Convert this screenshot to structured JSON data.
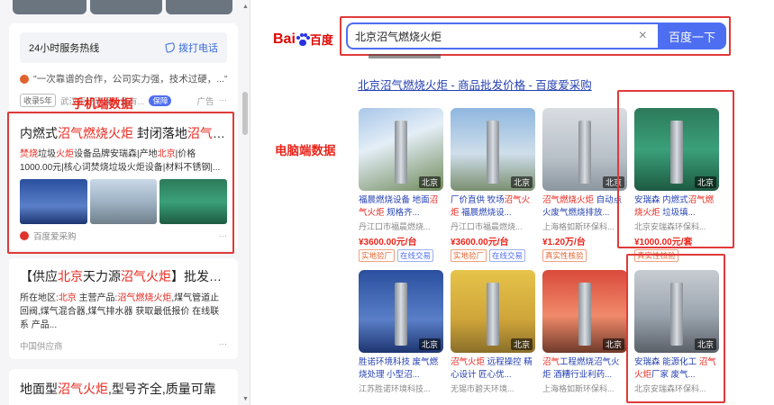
{
  "mobile": {
    "hotline": {
      "label": "24小时服务热线",
      "call": "拨打电话"
    },
    "quote": "\"一次靠谱的合作，公司实力强，技术过硬，...\"",
    "meta": {
      "badge_years": "收录5年",
      "company": "武汉炬炀环保设备有...",
      "badge_bao": "保障",
      "ad": "广告",
      "more": "···"
    },
    "label": "手机端数据",
    "ad_card": {
      "title_pre": "内燃式",
      "title_hl": "沼气燃烧火炬",
      "title_mid": "  封闭落地",
      "title_hl2": "沼气火",
      "title_end": "...",
      "desc_hl1": "焚烧",
      "desc_1": "垃圾",
      "desc_hl2": "火炬",
      "desc_2": "设备品牌安瑞森|产地",
      "desc_hl3": "北京",
      "desc_3": "|价格",
      "desc_line2": "1000.00元|核心词焚烧垃圾火炬设备|材料不锈钢|...",
      "source": "百度爱采购",
      "more": "···"
    },
    "supply_card": {
      "title_pre": "【供应",
      "title_hl": "北京",
      "title_mid": "天力源",
      "title_hl2": "沼气火炬",
      "title_end": "】批发_厂...",
      "desc_a": "所在地区:",
      "desc_hl1": "北京",
      "desc_b": " 主营产品:",
      "desc_hl2": "沼气燃烧火炬",
      "desc_c": ",煤气管道止回阀,煤气混合器,煤气排水器 获取最低报价 在线联系 产品...",
      "source": "中国供应商",
      "more": "···"
    },
    "ground_card": {
      "title_pre": "地面型",
      "title_hl": "沼气火炬",
      "title_end": ",型号齐全,质量可靠"
    }
  },
  "pc": {
    "logo": {
      "part1": "Bai",
      "part2": "百度"
    },
    "search": {
      "query": "北京沼气燃烧火炬",
      "clear": "×",
      "button": "百度一下"
    },
    "label": "电脑端数据",
    "result_title": {
      "hl": "北京沼气燃烧火炬",
      "rest": " - 商品批发价格 - 百度爱采购"
    },
    "products": [
      {
        "name_a": "福晨燃烧设备 地面",
        "name_hl": "沼气火炬",
        "name_b": " 规格齐...",
        "seller": "丹江口市福晨燃烧...",
        "price": "¥3600.00元/台",
        "tags": [
          "实地验厂",
          "在线交易"
        ],
        "img_tag": "北京"
      },
      {
        "name_a": "厂价直供 牧场",
        "name_hl": "沼气火炬",
        "name_b": " 福晨燃烧设...",
        "seller": "丹江口市福晨燃烧...",
        "price": "¥3600.00元/台",
        "tags": [
          "实地验厂",
          "在线交易"
        ],
        "img_tag": "北京"
      },
      {
        "name_a": "",
        "name_hl": "沼气燃烧火炬",
        "name_b": " 自动点火废气燃烧排放...",
        "seller": "上海格如斯环保科...",
        "price": "¥1.20万/台",
        "tags": [
          "真实性核验"
        ],
        "img_tag": "北京"
      },
      {
        "name_a": "安瑞森 内燃式",
        "name_hl": "沼气燃烧火炬",
        "name_b": " 垃圾填...",
        "seller": "北京安瑞森环保科...",
        "price": "¥1000.00元/套",
        "tags": [
          "真实性核验"
        ],
        "img_tag": "北京"
      },
      {
        "name_a": "胜诺环境科技 废气燃烧处理 小型沼...",
        "name_hl": "",
        "name_b": "",
        "seller": "江苏胜诺环境科技...",
        "price": "",
        "tags": [],
        "img_tag": "北京"
      },
      {
        "name_a": "",
        "name_hl": "沼气火炬",
        "name_b": " 远程操控 精心设计 匠心优...",
        "seller": "无锡市碧天环境...",
        "price": "",
        "tags": [],
        "img_tag": "北京"
      },
      {
        "name_a": "",
        "name_hl": "沼气",
        "name_b": "工程燃烧沼气火炬 酒糟行业利药...",
        "seller": "上海格如斯环保科...",
        "price": "",
        "tags": [],
        "img_tag": "北京"
      },
      {
        "name_a": "安瑞森 能源化工 ",
        "name_hl": "沼气火炬",
        "name_b": "厂家 废气...",
        "seller": "北京安瑞森环保科...",
        "price": "",
        "tags": [],
        "img_tag": "北京"
      }
    ]
  },
  "colors": {
    "accent_red": "#e8261c",
    "link_blue": "#2440b3",
    "baidu_blue": "#4e6ef2"
  }
}
